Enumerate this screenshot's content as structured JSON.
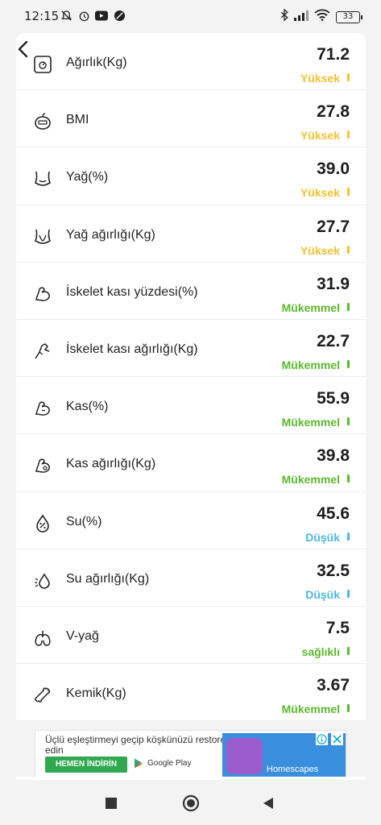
{
  "status_bar": {
    "time": "12:15",
    "left_icons": [
      "alarm-off-icon",
      "alarm-clock-icon",
      "youtube-icon",
      "app-icon"
    ],
    "right_icons": [
      "bluetooth-icon",
      "signal-icon",
      "wifi-icon"
    ],
    "battery": "33"
  },
  "metrics": [
    {
      "icon": "scale-icon",
      "label": "Ağırlık(Kg)",
      "value": "71.2",
      "status": "Yüksek",
      "status_color": "#f2c230"
    },
    {
      "icon": "bmi-icon",
      "label": "BMI",
      "value": "27.8",
      "status": "Yüksek",
      "status_color": "#f2c230"
    },
    {
      "icon": "body-fat-icon",
      "label": "Yağ(%)",
      "value": "39.0",
      "status": "Yüksek",
      "status_color": "#f2c230"
    },
    {
      "icon": "fat-weight-icon",
      "label": "Yağ ağırlığı(Kg)",
      "value": "27.7",
      "status": "Yüksek",
      "status_color": "#f2c230"
    },
    {
      "icon": "skeletal-muscle-icon",
      "label": "İskelet kası yüzdesi(%)",
      "value": "31.9",
      "status": "Mükemmel",
      "status_color": "#5cb82e"
    },
    {
      "icon": "skeletal-muscle-weight-icon",
      "label": "İskelet kası ağırlığı(Kg)",
      "value": "22.7",
      "status": "Mükemmel",
      "status_color": "#5cb82e"
    },
    {
      "icon": "muscle-icon",
      "label": "Kas(%)",
      "value": "55.9",
      "status": "Mükemmel",
      "status_color": "#5cb82e"
    },
    {
      "icon": "muscle-weight-icon",
      "label": "Kas ağırlığı(Kg)",
      "value": "39.8",
      "status": "Mükemmel",
      "status_color": "#5cb82e"
    },
    {
      "icon": "water-drop-icon",
      "label": "Su(%)",
      "value": "45.6",
      "status": "Düşük",
      "status_color": "#4fb7e8"
    },
    {
      "icon": "water-weight-icon",
      "label": "Su ağırlığı(Kg)",
      "value": "32.5",
      "status": "Düşük",
      "status_color": "#4fb7e8"
    },
    {
      "icon": "visceral-fat-icon",
      "label": "V-yağ",
      "value": "7.5",
      "status": "sağlıklı",
      "status_color": "#5cb82e"
    },
    {
      "icon": "bone-icon",
      "label": "Kemik(Kg)",
      "value": "3.67",
      "status": "Mükemmel",
      "status_color": "#5cb82e"
    }
  ],
  "ad": {
    "text": "Üçlü eşleştirmeyi geçip köşkünüzü restore edin",
    "install_label": "HEMEN İNDİRİN",
    "store_label": "Google Play",
    "game_name": "Homescapes"
  },
  "nav": {
    "buttons": [
      "recent-apps-icon",
      "home-icon",
      "back-icon"
    ]
  }
}
